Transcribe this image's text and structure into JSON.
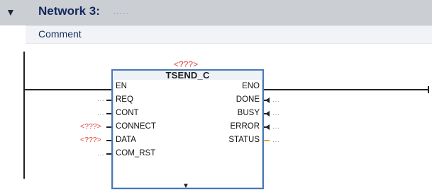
{
  "network": {
    "title": "Network 3:",
    "title_placeholder": ".....",
    "comment": "Comment"
  },
  "block": {
    "instance": "<???>",
    "name": "TSEND_C",
    "inputs": [
      {
        "pin": "EN",
        "operand": ""
      },
      {
        "pin": "REQ",
        "operand": "..."
      },
      {
        "pin": "CONT",
        "operand": "..."
      },
      {
        "pin": "CONNECT",
        "operand": "<???>"
      },
      {
        "pin": "DATA",
        "operand": "<???>"
      },
      {
        "pin": "COM_RST",
        "operand": "..."
      }
    ],
    "outputs": [
      {
        "pin": "ENO",
        "operand": ""
      },
      {
        "pin": "DONE",
        "operand": "..."
      },
      {
        "pin": "BUSY",
        "operand": "..."
      },
      {
        "pin": "ERROR",
        "operand": "..."
      },
      {
        "pin": "STATUS",
        "operand": "..."
      }
    ]
  },
  "colors": {
    "header_bg": "#cbcfd4",
    "title_text": "#13285c",
    "block_border": "#4a79b5",
    "unset_operand": "#e0403a",
    "status_stub": "#f0a030"
  },
  "icons": {
    "collapse": "triangle-down-icon",
    "expand": "triangle-down-icon"
  }
}
